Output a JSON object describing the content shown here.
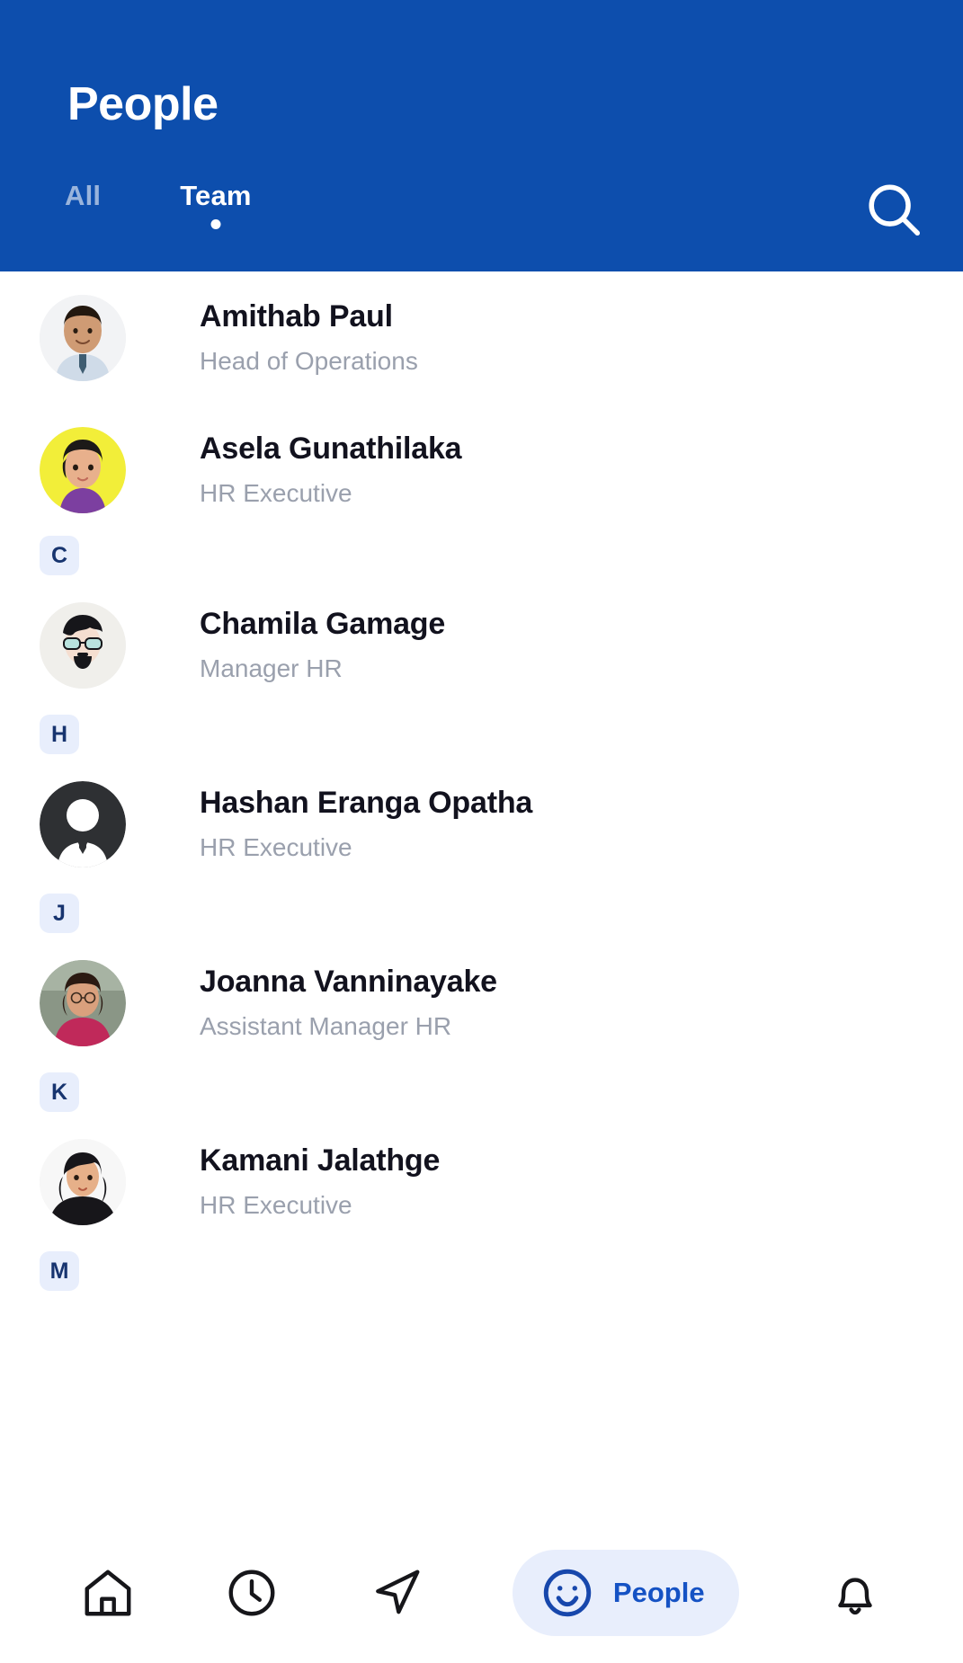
{
  "theme": {
    "header_bg": "#0d4ead",
    "accent": "#1552c4",
    "badge_bg": "#e8eefc",
    "badge_text": "#17346f",
    "name_color": "#12121e",
    "role_color": "#9aa0ad"
  },
  "header": {
    "title": "People",
    "search_icon": "search-icon",
    "tabs": [
      {
        "label": "All",
        "active": false
      },
      {
        "label": "Team",
        "active": true
      }
    ]
  },
  "list": [
    {
      "type": "person",
      "name": "Amithab Paul",
      "role": "Head of Operations",
      "avatar": "photo-man-tie"
    },
    {
      "type": "person",
      "name": "Asela Gunathilaka",
      "role": "HR Executive",
      "avatar": "illustration-yellow"
    },
    {
      "type": "section",
      "letter": "C"
    },
    {
      "type": "person",
      "name": "Chamila Gamage",
      "role": "Manager HR",
      "avatar": "illustration-glasses"
    },
    {
      "type": "section",
      "letter": "H"
    },
    {
      "type": "person",
      "name": "Hashan Eranga Opatha",
      "role": "HR Executive",
      "avatar": "silhouette-dark"
    },
    {
      "type": "section",
      "letter": "J"
    },
    {
      "type": "person",
      "name": "Joanna  Vanninayake",
      "role": "Assistant Manager HR",
      "avatar": "photo-woman-pink"
    },
    {
      "type": "section",
      "letter": "K"
    },
    {
      "type": "person",
      "name": "Kamani Jalathge",
      "role": "HR Executive",
      "avatar": "photo-woman-dark"
    },
    {
      "type": "section",
      "letter": "M"
    }
  ],
  "bottom_nav": [
    {
      "icon": "home-icon",
      "label": "",
      "active": false
    },
    {
      "icon": "clock-icon",
      "label": "",
      "active": false
    },
    {
      "icon": "navigation-arrow-icon",
      "label": "",
      "active": false
    },
    {
      "icon": "smiley-icon",
      "label": "People",
      "active": true
    },
    {
      "icon": "bell-icon",
      "label": "",
      "active": false
    }
  ]
}
